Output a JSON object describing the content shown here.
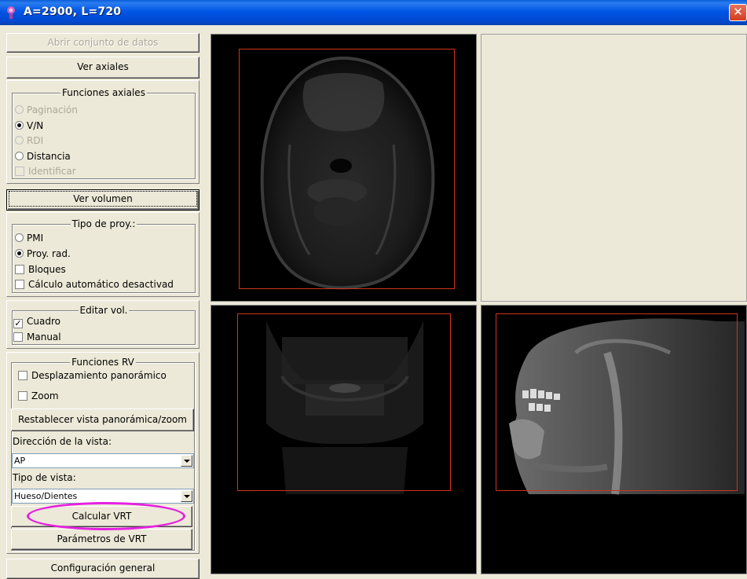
{
  "window": {
    "title": "A=2900, L=720",
    "close_glyph": "✕"
  },
  "buttons": {
    "open_dataset": "Abrir conjunto de datos",
    "view_axial": "Ver axiales",
    "view_volume": "Ver volumen",
    "reset_pan_zoom": "Restablecer vista panorámica/zoom",
    "compute_vrt": "Calcular VRT",
    "vrt_params": "Parámetros de VRT",
    "general_config": "Configuración general"
  },
  "axial_functions": {
    "title": "Funciones axiales",
    "options": [
      {
        "label": "Paginación",
        "checked": false,
        "enabled": false
      },
      {
        "label": "V/N",
        "checked": true,
        "enabled": true
      },
      {
        "label": "RDI",
        "checked": false,
        "enabled": false
      },
      {
        "label": "Distancia",
        "checked": false,
        "enabled": true
      }
    ],
    "identify": {
      "label": "Identificar",
      "checked": false,
      "enabled": false
    }
  },
  "projection_type": {
    "title": "Tipo de proy.:",
    "options": [
      {
        "label": "PMI",
        "checked": false
      },
      {
        "label": "Proy. rad.",
        "checked": true
      }
    ],
    "blocks": {
      "label": "Bloques",
      "checked": false
    },
    "auto_calc": {
      "label": "Cálculo automático desactivad",
      "checked": false
    }
  },
  "edit_volume": {
    "title": "Editar vol.",
    "box": {
      "label": "Cuadro",
      "checked": true
    },
    "manual": {
      "label": "Manual",
      "checked": false
    }
  },
  "vr_functions": {
    "title": "Funciones RV",
    "pan": {
      "label": "Desplazamiento panorámico",
      "checked": false
    },
    "zoom": {
      "label": "Zoom",
      "checked": false
    },
    "view_direction_label": "Dirección de la vista:",
    "view_direction_value": "AP",
    "view_type_label": "Tipo de vista:",
    "view_type_value": "Hueso/Dientes"
  },
  "colors": {
    "roi": "#d0341c",
    "highlight": "#e620e0",
    "titlebar": "#0055e5"
  },
  "icons": {
    "app": "app-icon",
    "close": "close-icon",
    "dropdown": "chevron-down-icon"
  }
}
